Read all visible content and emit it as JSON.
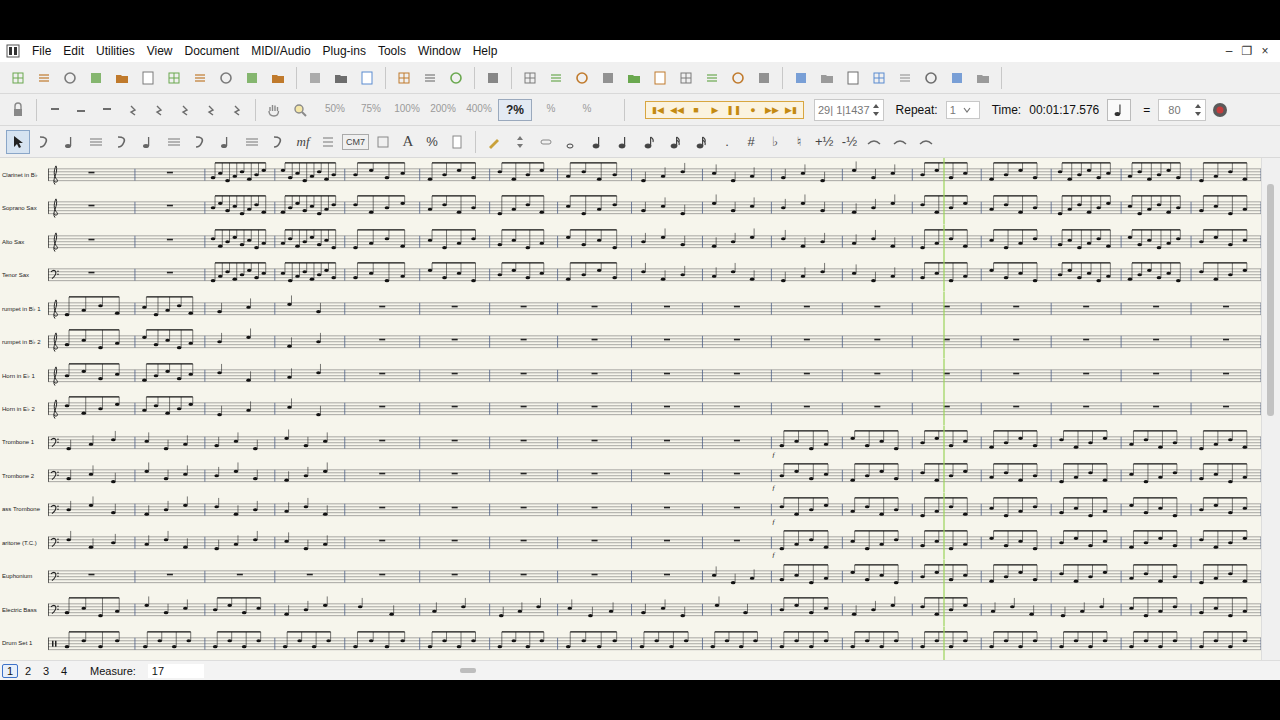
{
  "menu": {
    "items": [
      "File",
      "Edit",
      "Utilities",
      "View",
      "Document",
      "MIDI/Audio",
      "Plug-ins",
      "Tools",
      "Window",
      "Help"
    ]
  },
  "window_controls": [
    "–",
    "❐",
    "×"
  ],
  "zoom": [
    {
      "label": "50%",
      "selected": false
    },
    {
      "label": "75%",
      "selected": false
    },
    {
      "label": "100%",
      "selected": false
    },
    {
      "label": "200%",
      "selected": false
    },
    {
      "label": "400%",
      "selected": false
    },
    {
      "label": "?%",
      "selected": true
    },
    {
      "label": "%",
      "selected": false
    },
    {
      "label": "%",
      "selected": false
    }
  ],
  "transport": [
    "▮◀",
    "◀◀",
    "■",
    "▶",
    "❚❚",
    "●",
    "▶▶",
    "▶▮"
  ],
  "counter": "29| 1|1437",
  "repeat": {
    "label": "Repeat:",
    "value": "1"
  },
  "time": {
    "label": "Time:",
    "value": "00:01:17.576"
  },
  "tempo": {
    "equals": "=",
    "value": "80"
  },
  "tool_palette": {
    "active": "selection"
  },
  "tool_text": [
    "mf",
    "CM7",
    "A",
    "%"
  ],
  "note_tools": [
    ".",
    "#",
    "♭",
    "♮",
    "+½",
    "-½"
  ],
  "staves": [
    {
      "name": "Clarinet in B♭",
      "clef": "treble",
      "notes": [
        0,
        0,
        8,
        8,
        4,
        4,
        4,
        4,
        3,
        3,
        3,
        3,
        4,
        4,
        6,
        6,
        4
      ],
      "dynamics": []
    },
    {
      "name": "Soprano Sax",
      "clef": "treble",
      "notes": [
        0,
        0,
        8,
        8,
        4,
        4,
        4,
        4,
        3,
        3,
        3,
        3,
        4,
        4,
        6,
        6,
        4
      ],
      "dynamics": []
    },
    {
      "name": "Alto Sax",
      "clef": "treble",
      "notes": [
        0,
        0,
        8,
        8,
        4,
        4,
        4,
        4,
        3,
        3,
        3,
        3,
        4,
        4,
        6,
        6,
        4
      ],
      "dynamics": []
    },
    {
      "name": "Tenor Sax",
      "clef": "bass",
      "notes": [
        0,
        0,
        8,
        8,
        4,
        4,
        4,
        4,
        3,
        3,
        3,
        3,
        4,
        4,
        6,
        6,
        4
      ],
      "dynamics": []
    },
    {
      "name": "rumpet in B♭ 1",
      "clef": "treble",
      "notes": [
        4,
        5,
        2,
        2,
        0,
        0,
        0,
        0,
        0,
        0,
        0,
        0,
        0,
        0,
        0,
        0,
        0
      ],
      "dynamics": []
    },
    {
      "name": "rumpet in B♭ 2",
      "clef": "treble",
      "notes": [
        4,
        5,
        2,
        2,
        0,
        0,
        0,
        0,
        0,
        0,
        0,
        0,
        0,
        0,
        0,
        0,
        0
      ],
      "dynamics": []
    },
    {
      "name": "Horn in E♭ 1",
      "clef": "treble",
      "notes": [
        4,
        5,
        2,
        2,
        0,
        0,
        0,
        0,
        0,
        0,
        0,
        0,
        0,
        0,
        0,
        0,
        0
      ],
      "dynamics": []
    },
    {
      "name": "Horn in E♭ 2",
      "clef": "treble",
      "notes": [
        4,
        5,
        2,
        2,
        0,
        0,
        0,
        0,
        0,
        0,
        0,
        0,
        0,
        0,
        0,
        0,
        0
      ],
      "dynamics": []
    },
    {
      "name": "Trombone 1",
      "clef": "bass",
      "notes": [
        3,
        3,
        3,
        3,
        0,
        0,
        0,
        0,
        0,
        0,
        4,
        4,
        4,
        4,
        4,
        4,
        4
      ],
      "dynamics": [
        {
          "measure": 11,
          "text": "f"
        }
      ]
    },
    {
      "name": "Trombone 2",
      "clef": "bass",
      "notes": [
        3,
        3,
        3,
        3,
        0,
        0,
        0,
        0,
        0,
        0,
        4,
        4,
        4,
        4,
        4,
        4,
        4
      ],
      "dynamics": [
        {
          "measure": 11,
          "text": "f"
        }
      ]
    },
    {
      "name": "ass Trombone",
      "clef": "bass",
      "notes": [
        3,
        3,
        3,
        3,
        0,
        0,
        0,
        0,
        0,
        0,
        4,
        4,
        4,
        4,
        4,
        4,
        4
      ],
      "dynamics": [
        {
          "measure": 11,
          "text": "f"
        }
      ]
    },
    {
      "name": "aritone (T.C.)",
      "clef": "bass",
      "notes": [
        3,
        3,
        3,
        3,
        0,
        0,
        0,
        0,
        0,
        0,
        4,
        4,
        4,
        4,
        4,
        4,
        4
      ],
      "dynamics": [
        {
          "measure": 11,
          "text": "f"
        }
      ]
    },
    {
      "name": "Euphonium",
      "clef": "bass",
      "notes": [
        0,
        0,
        0,
        0,
        0,
        0,
        0,
        0,
        0,
        3,
        4,
        4,
        4,
        4,
        4,
        4,
        4
      ],
      "dynamics": []
    },
    {
      "name": "Electric Bass",
      "clef": "bass",
      "notes": [
        4,
        3,
        4,
        3,
        2,
        2,
        3,
        3,
        3,
        2,
        4,
        3,
        4,
        3,
        3,
        4,
        4
      ],
      "dynamics": []
    },
    {
      "name": "Drum Set 1",
      "clef": "percussion",
      "notes": [
        4,
        4,
        4,
        4,
        4,
        4,
        4,
        4,
        4,
        4,
        4,
        4,
        4,
        4,
        4,
        4,
        4
      ],
      "dynamics": []
    }
  ],
  "playback": {
    "measure": 13,
    "level": 0.46
  },
  "pages": [
    {
      "label": "1",
      "selected": true
    },
    {
      "label": "2",
      "selected": false
    },
    {
      "label": "3",
      "selected": false
    },
    {
      "label": "4",
      "selected": false
    }
  ],
  "measure_field": {
    "label": "Measure:",
    "value": "17"
  }
}
